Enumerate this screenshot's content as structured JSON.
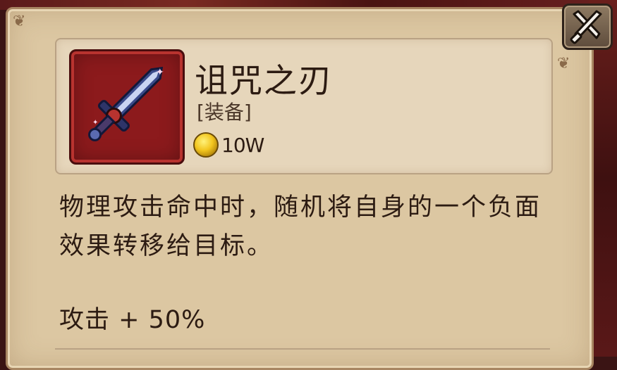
{
  "item": {
    "name": "诅咒之刃",
    "type": "[装备]",
    "price": "10W",
    "description": "物理攻击命中时，随机将自身的一个负面效果转移给目标。",
    "stat": "攻击 + 50%"
  },
  "icons": {
    "item_icon": "sword-icon",
    "currency_icon": "gold-coin-icon",
    "close_icon": "crossed-swords-close-icon"
  },
  "colors": {
    "panel_bg": "#dcc7a2",
    "header_bg": "#e6d6bb",
    "icon_frame": "#8c1a1c",
    "text": "#2c1b12",
    "coin": "#f2c51e"
  }
}
